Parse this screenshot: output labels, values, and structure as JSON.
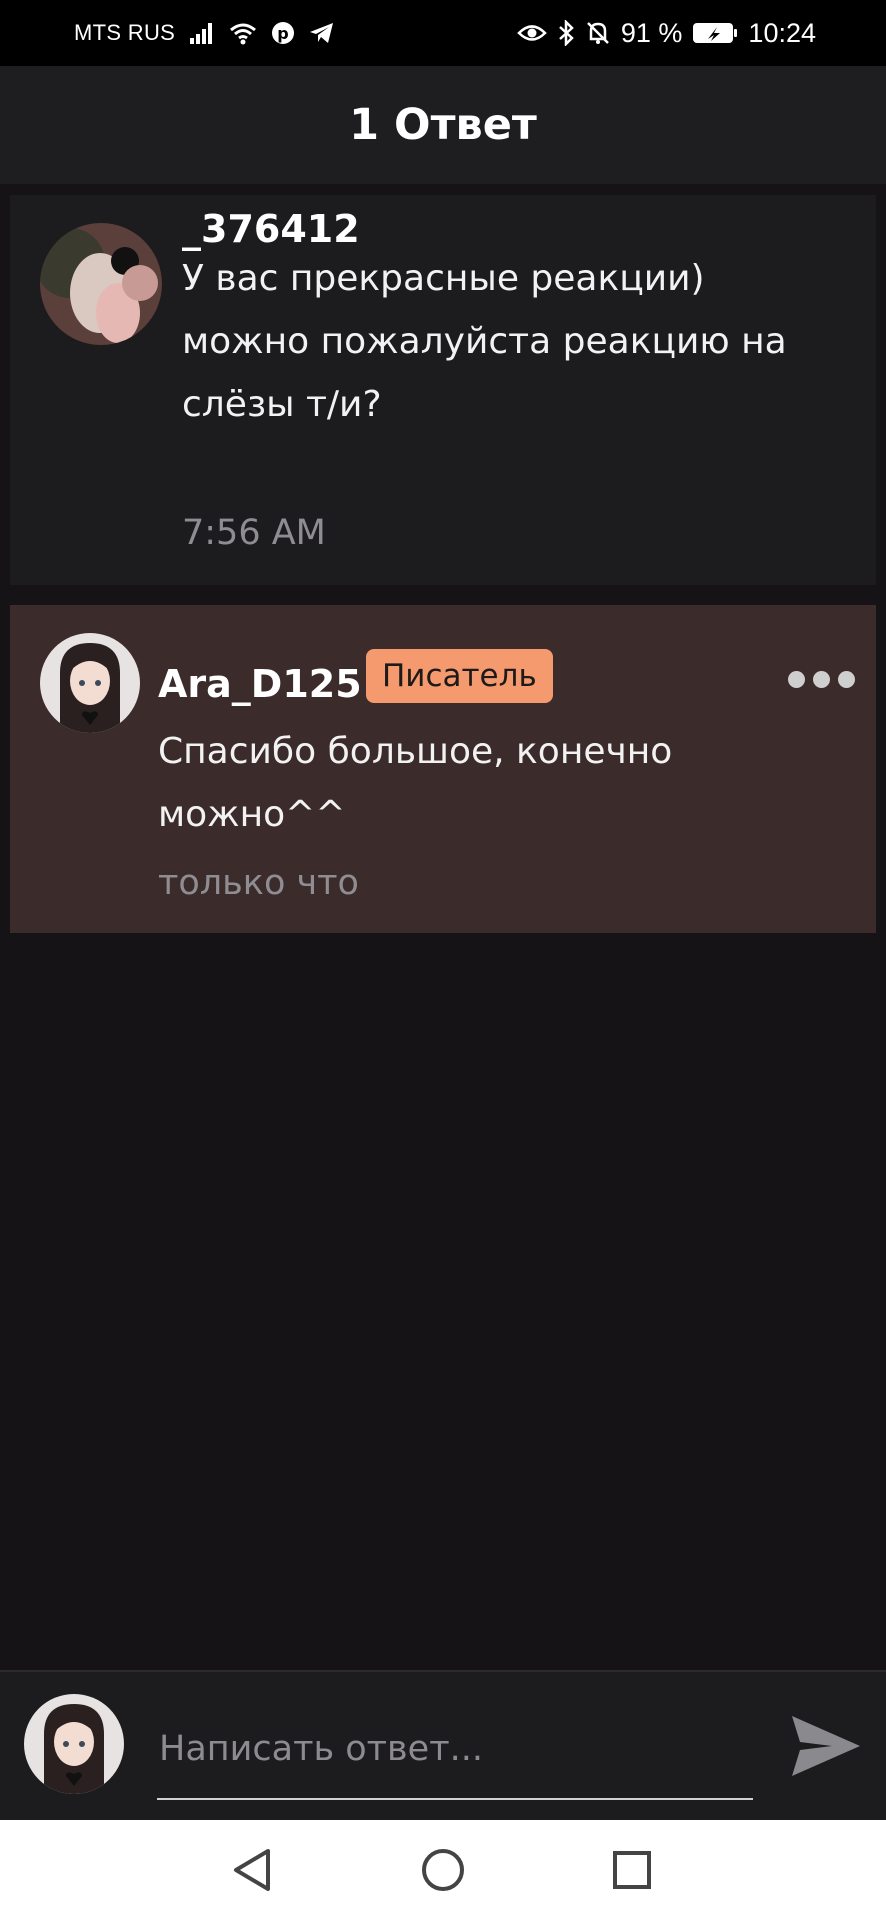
{
  "status_bar": {
    "carrier": "MTS RUS",
    "battery": "91 %",
    "time": "10:24",
    "icons": [
      "signal-icon",
      "wifi-icon",
      "pinterest-icon",
      "telegram-icon",
      "eye-icon",
      "bluetooth-icon",
      "mute-bell-icon",
      "battery-icon"
    ]
  },
  "header": {
    "title": "1 Ответ"
  },
  "parent_comment": {
    "username": "_376412",
    "text_lines": [
      "У вас прекрасные реакции)",
      "можно пожалуйста реакцию на",
      "слёзы т/и?"
    ],
    "timestamp": "7:56 AM"
  },
  "reply_comment": {
    "username": "Ara_D125",
    "badge": "Писатель",
    "text_lines": [
      "Спасибо большое, конечно",
      "можно^^"
    ],
    "timestamp": "только что",
    "colors": {
      "card_bg": "#3b2c2b",
      "badge_bg": "#f59a6e"
    }
  },
  "reply_bar": {
    "placeholder": "Написать ответ..."
  },
  "nav_bar": {
    "icons": [
      "back-icon",
      "home-icon",
      "recents-icon"
    ]
  }
}
